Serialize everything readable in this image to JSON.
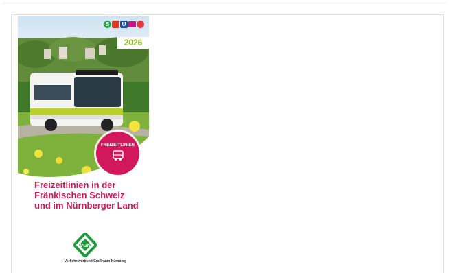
{
  "brochure": {
    "year": "2026",
    "badge_label": "FREIZEITLINIEN",
    "title_lines": [
      "Freizeitlinien in der",
      "Fränkischen Schweiz",
      "und im Nürnberger Land"
    ],
    "logo_text": "VGN",
    "logo_caption": "Verkehrsverbund Großraum Nürnberg",
    "top_logos": [
      "S",
      "R",
      "U",
      "tram",
      "bus"
    ]
  },
  "colors": {
    "accent_magenta": "#d2185c",
    "year_green": "#8dbd1f",
    "vgn_green": "#1f9a3c"
  }
}
